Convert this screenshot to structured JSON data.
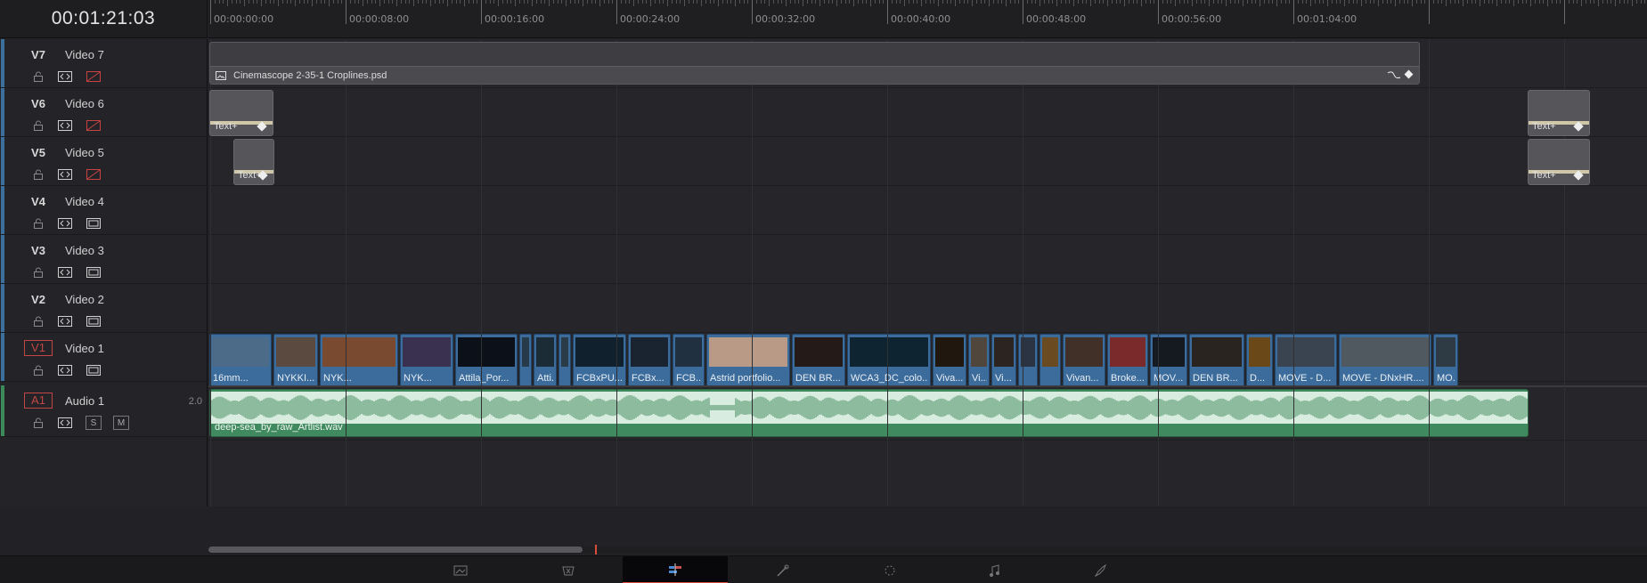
{
  "timecode": "00:01:21:03",
  "ruler": {
    "labels": [
      "00:00:00:00",
      "00:00:08:00",
      "00:00:16:00",
      "00:00:24:00",
      "00:00:32:00",
      "00:00:40:00",
      "00:00:48:00",
      "00:00:56:00",
      "00:01:04:00"
    ]
  },
  "tracks": [
    {
      "id": "V7",
      "name": "Video 7",
      "monitor": "disabled"
    },
    {
      "id": "V6",
      "name": "Video 6",
      "monitor": "disabled"
    },
    {
      "id": "V5",
      "name": "Video 5",
      "monitor": "disabled"
    },
    {
      "id": "V4",
      "name": "Video 4",
      "monitor": "enabled"
    },
    {
      "id": "V3",
      "name": "Video 3",
      "monitor": "enabled"
    },
    {
      "id": "V2",
      "name": "Video 2",
      "monitor": "enabled"
    },
    {
      "id": "V1",
      "name": "Video 1",
      "monitor": "enabled"
    }
  ],
  "audio_track": {
    "id": "A1",
    "name": "Audio 1",
    "channels": "2.0",
    "solo_label": "S",
    "mute_label": "M"
  },
  "clips": {
    "v7": {
      "name": "Cinemascope 2-35-1 Croplines.psd"
    },
    "text_label": "Text+",
    "v1": [
      "16mm...",
      "NYKKI...",
      "NYK...",
      "NYK...",
      "Attila_Por...",
      "",
      "Atti...",
      "",
      "FCBxPU...",
      "FCBx...",
      "FCB...",
      "Astrid portfolio...",
      "DEN BR...",
      "WCA3_DC_colo...",
      "Viva...",
      "Vi...",
      "Vi...",
      "",
      "",
      "Vivan...",
      "Broke...",
      "MOV...",
      "DEN BR...",
      "D...",
      "MOVE - D...",
      "MOVE - DNxHR....",
      "MO..."
    ],
    "audio": {
      "name": "deep-sea_by_raw_Artlist.wav"
    }
  },
  "page_bar": {
    "pages": [
      "media",
      "cut",
      "edit",
      "fusion",
      "color",
      "fairlight",
      "deliver"
    ],
    "active": "edit"
  },
  "colors": {
    "video_clip": "#3c6c9c",
    "audio_clip": "#3f8a5e",
    "text_clip": "#55555a",
    "accent_red": "#d84a3a"
  }
}
